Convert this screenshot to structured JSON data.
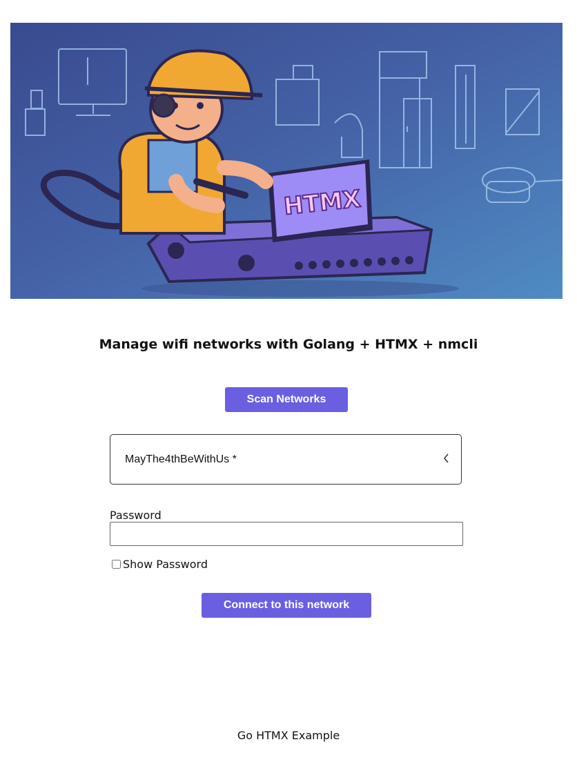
{
  "hero": {
    "screen_text": "HTMX",
    "colors": {
      "background": "#4565a8",
      "sketch": "#9fc3ec",
      "helmet": "#f0a832",
      "device": "#5a4fb0",
      "screen": "#9d8cf5"
    }
  },
  "page": {
    "title": "Manage wifi networks with Golang + HTMX + nmcli"
  },
  "actions": {
    "scan_label": "Scan Networks",
    "connect_label": "Connect to this network"
  },
  "network_select": {
    "selected": "MayThe4thBeWithUs *",
    "icon": "chevron-left-icon"
  },
  "password": {
    "label": "Password",
    "value": "",
    "placeholder": ""
  },
  "show_password": {
    "label": "Show Password",
    "checked": false
  },
  "footer": {
    "text": "Go HTMX Example"
  },
  "theme": {
    "accent": "#6a5fe0"
  }
}
